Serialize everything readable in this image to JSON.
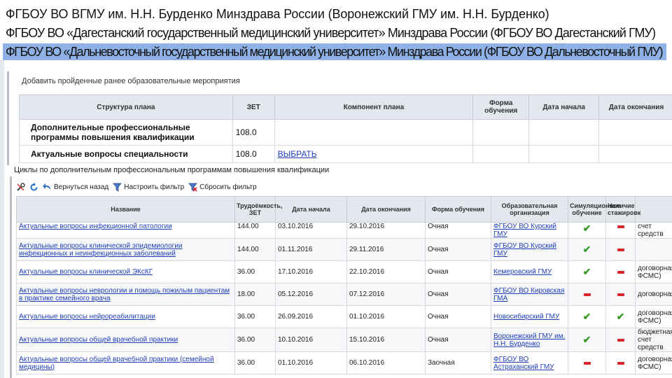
{
  "organizations": [
    "ФГБОУ ВО ВГМУ им. Н.Н. Бурденко Минздрава России (Воронежский ГМУ им. Н.Н. Бурденко)",
    "ФГБОУ ВО «Дагестанский государственный медицинский университет» Минздрава России (ФГБОУ ВО Дагестанский ГМУ)",
    "ФГБОУ ВО «Дальневосточный государственный медицинский университет» Минздрава России (ФГБОУ ВО Дальневосточный ГМУ)"
  ],
  "selected_org_index": 2,
  "plan": {
    "title": "Добавить пройденные ранее образовательные мероприятия",
    "headers": [
      "Структура плана",
      "ЗЕТ",
      "Компонент плана",
      "Форма обучения",
      "Дата начала",
      "Дата окончания"
    ],
    "rows": [
      {
        "name": "Дополнительные профессиональные программы повышения квалификации",
        "zet": "108.0",
        "component": ""
      },
      {
        "name": "Актуальные вопросы специальности",
        "zet": "108.0",
        "component": "ВЫБРАТЬ"
      }
    ]
  },
  "cycles": {
    "caption": "Циклы по дополнительным профессиональным программам повышения квалификации",
    "toolbar": {
      "back": "Вернуться назад",
      "set_filter": "Настроить фильтр",
      "reset_filter": "Сбросить фильтр"
    },
    "headers": [
      "Название",
      "Трудоёмкость, ЗЕТ",
      "Дата начала",
      "Дата окончания",
      "Форма обучения",
      "Образовательная организация",
      "Симуляционное обучение",
      "Наличие стажировк",
      ""
    ],
    "rows": [
      {
        "name": "Актуальные вопросы инфекционной патологии",
        "zet": "144.00",
        "start": "03.10.2016",
        "end": "29.10.2016",
        "form": "Очная",
        "org": "ФГБОУ ВО Курский ГМУ",
        "sim": true,
        "intern": false,
        "finance": "счет средств"
      },
      {
        "name": "Актуальные вопросы клинической эпидемиологии инфекционных и неинфекционных заболеваний",
        "zet": "144.00",
        "start": "01.11.2016",
        "end": "29.11.2016",
        "form": "Очная",
        "org": "ФГБОУ ВО Курский ГМУ",
        "sim": true,
        "intern": false,
        "finance": ""
      },
      {
        "name": "Актуальные вопросы клинической ЭКсКГ",
        "zet": "36.00",
        "start": "17.10.2016",
        "end": "22.10.2016",
        "form": "Очная",
        "org": "Кемеровский ГМУ",
        "sim": true,
        "intern": false,
        "finance": "договорная, ФСМС)"
      },
      {
        "name": "Актуальные вопросы неврологии и помощь пожилым пациентам в практике семейного врача",
        "zet": "18.00",
        "start": "05.12.2016",
        "end": "07.12.2016",
        "form": "Очная",
        "org": "ФГБОУ ВО Кировская ГМА",
        "sim": false,
        "intern": false,
        "finance": "договорная"
      },
      {
        "name": "Актуальные вопросы нейрореабилитации",
        "zet": "36.00",
        "start": "26.09.2016",
        "end": "01.10.2016",
        "form": "Очная",
        "org": "Новосибирский ГМУ",
        "sim": true,
        "intern": true,
        "finance": "договорная, ФСМС)"
      },
      {
        "name": "Актуальные вопросы общей врачебной практики",
        "zet": "36.00",
        "start": "10.10.2016",
        "end": "15.10.2016",
        "form": "Очная",
        "org": "Воронежский ГМУ им. Н.Н. Бурденко",
        "sim": true,
        "intern": false,
        "finance": "бюджетная, счет средств"
      },
      {
        "name": "Актуальные вопросы общей врачебной практики (семейной медицины)",
        "zet": "36.00",
        "start": "01.10.2016",
        "end": "06.10.2016",
        "form": "Заочная",
        "org": "ФГБОУ ВО Астраханский ГМУ",
        "sim": false,
        "intern": false,
        "finance": "договорная, ФСМС)"
      }
    ]
  },
  "colors": {
    "selection": "#8eb2e6",
    "link": "#1f3fb8",
    "check": "#3a9a2a",
    "dash": "#d8242b"
  }
}
